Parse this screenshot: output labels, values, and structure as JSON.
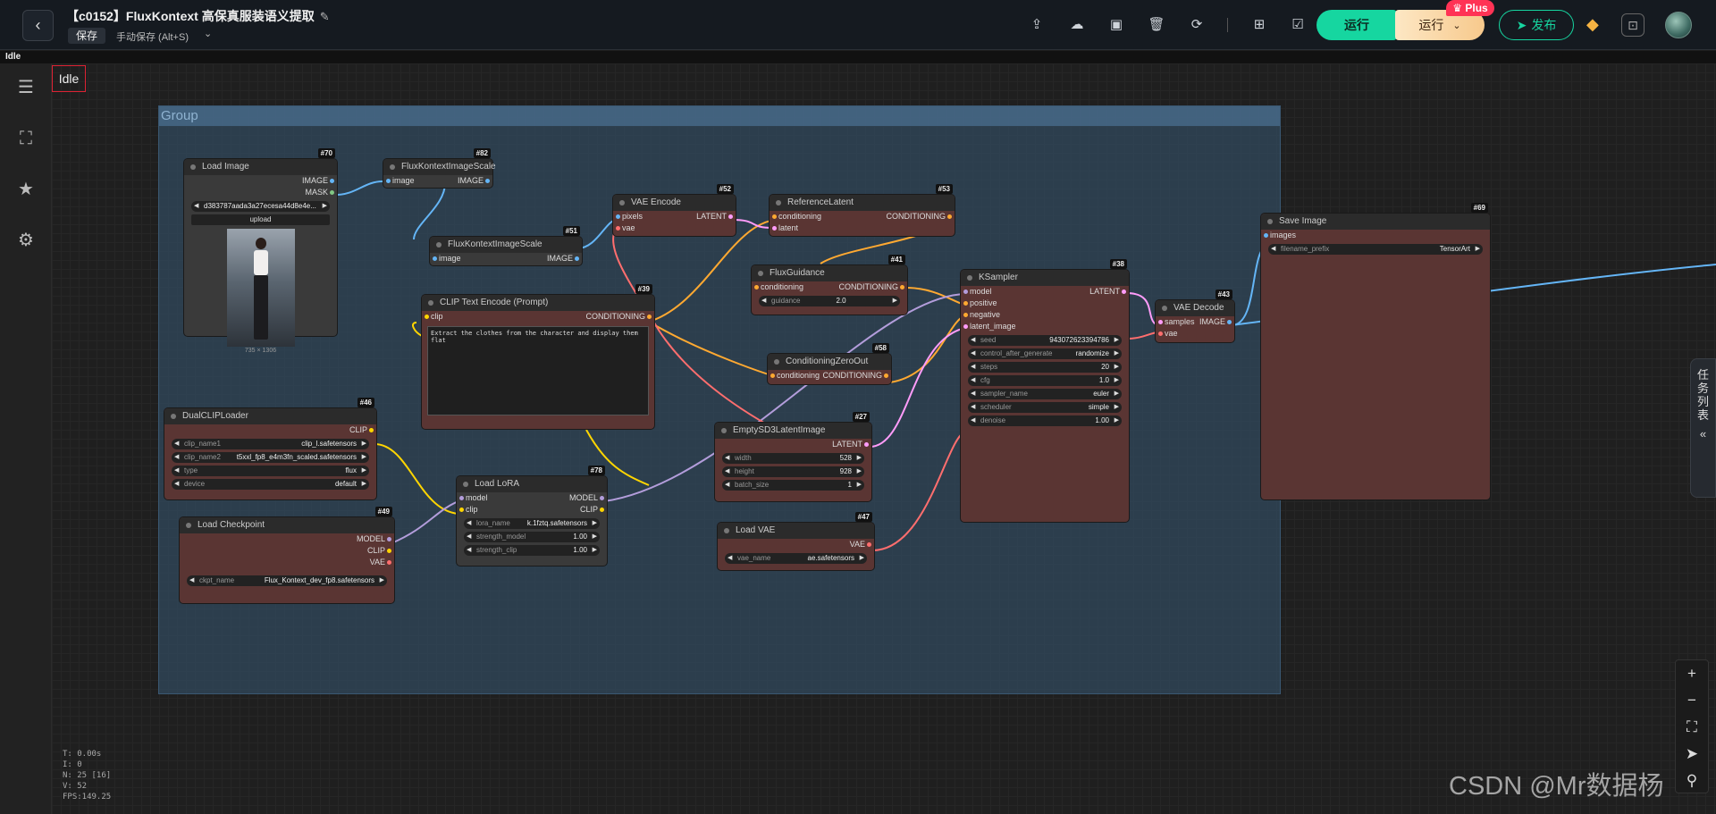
{
  "header": {
    "title": "【c0152】FluxKontext 高保真服装语义提取",
    "save_label": "保存",
    "autosave_label": "手动保存 (Alt+S)",
    "run_label": "运行",
    "run_plus_label": "运行",
    "plus_badge": "Plus",
    "publish_label": "发布"
  },
  "status_strip": "Idle",
  "canvas": {
    "idle_label": "Idle",
    "group_title": "Group",
    "stats": [
      "T: 0.00s",
      "I: 0",
      "N: 25 [16]",
      "V: 52",
      "FPS:149.25"
    ],
    "task_tab": "任务列表",
    "watermark": "CSDN @Mr数据杨"
  },
  "colors": {
    "accent_run": "#16d6a0",
    "plus_badge": "#ff3355",
    "node_body": "#5a3533",
    "group_fill": "#324b5f",
    "link_clip": "#ffd500",
    "link_conditioning": "#ffa931",
    "link_latent": "#ff9cf9",
    "link_image": "#64b5f6",
    "link_model": "#b39ddb",
    "link_vae": "#ff6e6e"
  },
  "nodes": {
    "load_image": {
      "id": "#70",
      "title": "Load Image",
      "out1": "IMAGE",
      "out2": "MASK",
      "file": "d383787aada3a27ecesa44d8e4e...",
      "upload": "upload",
      "caption": "735 × 1306"
    },
    "scale82": {
      "id": "#82",
      "title": "FluxKontextImageScale",
      "in1": "image",
      "out1": "IMAGE"
    },
    "scale51": {
      "id": "#51",
      "title": "FluxKontextImageScale",
      "in1": "image",
      "out1": "IMAGE"
    },
    "vae_encode": {
      "id": "#52",
      "title": "VAE Encode",
      "in1": "pixels",
      "in2": "vae",
      "out1": "LATENT"
    },
    "ref_latent": {
      "id": "#53",
      "title": "ReferenceLatent",
      "in1": "conditioning",
      "in2": "latent",
      "out1": "CONDITIONING"
    },
    "flux_guidance": {
      "id": "#41",
      "title": "FluxGuidance",
      "in1": "conditioning",
      "out1": "CONDITIONING",
      "w1l": "guidance",
      "w1v": "2.0"
    },
    "clip_text": {
      "id": "#39",
      "title": "CLIP Text Encode (Prompt)",
      "in1": "clip",
      "out1": "CONDITIONING",
      "text": "Extract the clothes from the character and display them flat"
    },
    "cond_zero": {
      "id": "#58",
      "title": "ConditioningZeroOut",
      "in1": "conditioning",
      "out1": "CONDITIONING"
    },
    "ksampler": {
      "id": "#38",
      "title": "KSampler",
      "in1": "model",
      "in2": "positive",
      "in3": "negative",
      "in4": "latent_image",
      "out1": "LATENT",
      "w": [
        [
          "seed",
          "943072623394786"
        ],
        [
          "control_after_generate",
          "randomize"
        ],
        [
          "steps",
          "20"
        ],
        [
          "cfg",
          "1.0"
        ],
        [
          "sampler_name",
          "euler"
        ],
        [
          "scheduler",
          "simple"
        ],
        [
          "denoise",
          "1.00"
        ]
      ]
    },
    "vae_decode": {
      "id": "#43",
      "title": "VAE Decode",
      "in1": "samples",
      "in2": "vae",
      "out1": "IMAGE"
    },
    "save_image": {
      "id": "#69",
      "title": "Save Image",
      "in1": "images",
      "w1l": "filename_prefix",
      "w1v": "TensorArt"
    },
    "dual_clip": {
      "id": "#46",
      "title": "DualCLIPLoader",
      "out1": "CLIP",
      "w": [
        [
          "clip_name1",
          "clip_l.safetensors"
        ],
        [
          "clip_name2",
          "t5xxl_fp8_e4m3fn_scaled.safetensors"
        ],
        [
          "type",
          "flux"
        ],
        [
          "device",
          "default"
        ]
      ]
    },
    "empty_latent": {
      "id": "#27",
      "title": "EmptySD3LatentImage",
      "out1": "LATENT",
      "w": [
        [
          "width",
          "528"
        ],
        [
          "height",
          "928"
        ],
        [
          "batch_size",
          "1"
        ]
      ]
    },
    "load_lora": {
      "id": "#78",
      "title": "Load LoRA",
      "in1": "model",
      "in2": "clip",
      "out1": "MODEL",
      "out2": "CLIP",
      "w": [
        [
          "lora_name",
          "k.1fztq.safetensors"
        ],
        [
          "strength_model",
          "1.00"
        ],
        [
          "strength_clip",
          "1.00"
        ]
      ]
    },
    "load_ckpt": {
      "id": "#49",
      "title": "Load Checkpoint",
      "out1": "MODEL",
      "out2": "CLIP",
      "out3": "VAE",
      "w1l": "ckpt_name",
      "w1v": "Flux_Kontext_dev_fp8.safetensors"
    },
    "load_vae": {
      "id": "#47",
      "title": "Load VAE",
      "out1": "VAE",
      "w1l": "vae_name",
      "w1v": "ae.safetensors"
    }
  }
}
